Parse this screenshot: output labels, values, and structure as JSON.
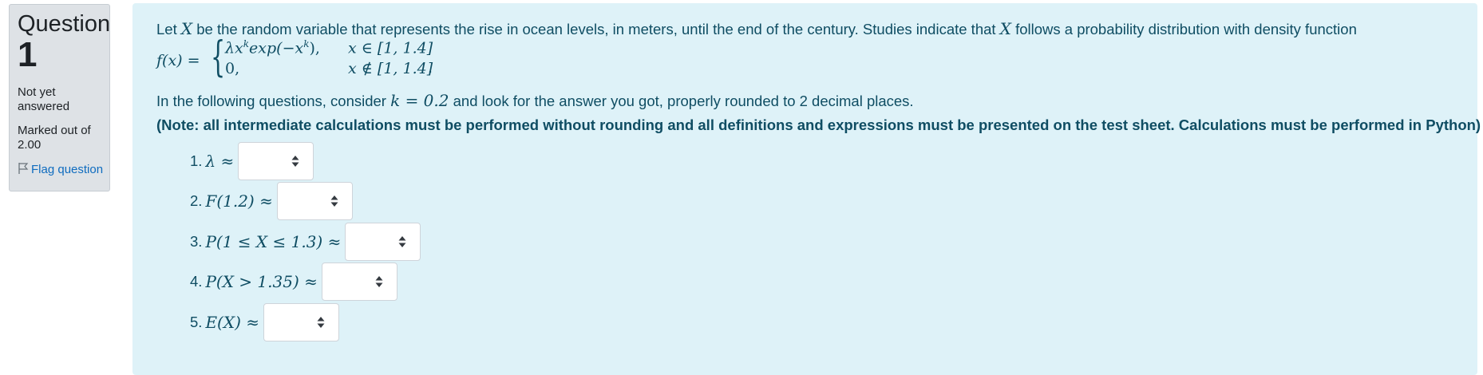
{
  "info": {
    "question_word": "Question",
    "question_number": "1",
    "state": "Not yet answered",
    "grade": "Marked out of 2.00",
    "flag_label": "Flag question"
  },
  "question": {
    "intro_before_x": "Let",
    "intro_var": "X",
    "intro_middle": "be the random variable that represents the rise in ocean levels, in meters, until the end of the century. Studies indicate that",
    "intro_var2": "X",
    "intro_after": "follows a probability distribution with density function",
    "formula": {
      "lhs": "f(x) =",
      "case1_expr": "λx",
      "case1_exp": "k",
      "case1_rest": "exp(−x",
      "case1_exp2": "k",
      "case1_end": "),",
      "case1_cond": "x ∈ [1, 1.4]",
      "case2_expr": "0,",
      "case2_cond": "x ∉ [1, 1.4]",
      "end_dot": "."
    },
    "line2_before": "In the following questions, consider",
    "line2_math": "k = 0.2",
    "line2_after": "and look for the answer you got, properly rounded to 2 decimal places.",
    "note": "(Note: all intermediate calculations must be performed without rounding and all definitions and expressions must be presented on the test sheet. Calculations must be performed in Python)"
  },
  "subquestions": [
    {
      "num": "1.",
      "expr": "λ ≈",
      "selected": ""
    },
    {
      "num": "2.",
      "expr": "F(1.2) ≈",
      "selected": ""
    },
    {
      "num": "3.",
      "expr": "P(1 ≤ X ≤ 1.3) ≈",
      "selected": ""
    },
    {
      "num": "4.",
      "expr": "P(X > 1.35) ≈",
      "selected": ""
    },
    {
      "num": "5.",
      "expr": "E(X) ≈",
      "selected": ""
    }
  ],
  "colors": {
    "info_bg": "#dee2e6",
    "content_bg": "#def2f8",
    "text": "#0f4d63",
    "link": "#0f6cbf"
  }
}
